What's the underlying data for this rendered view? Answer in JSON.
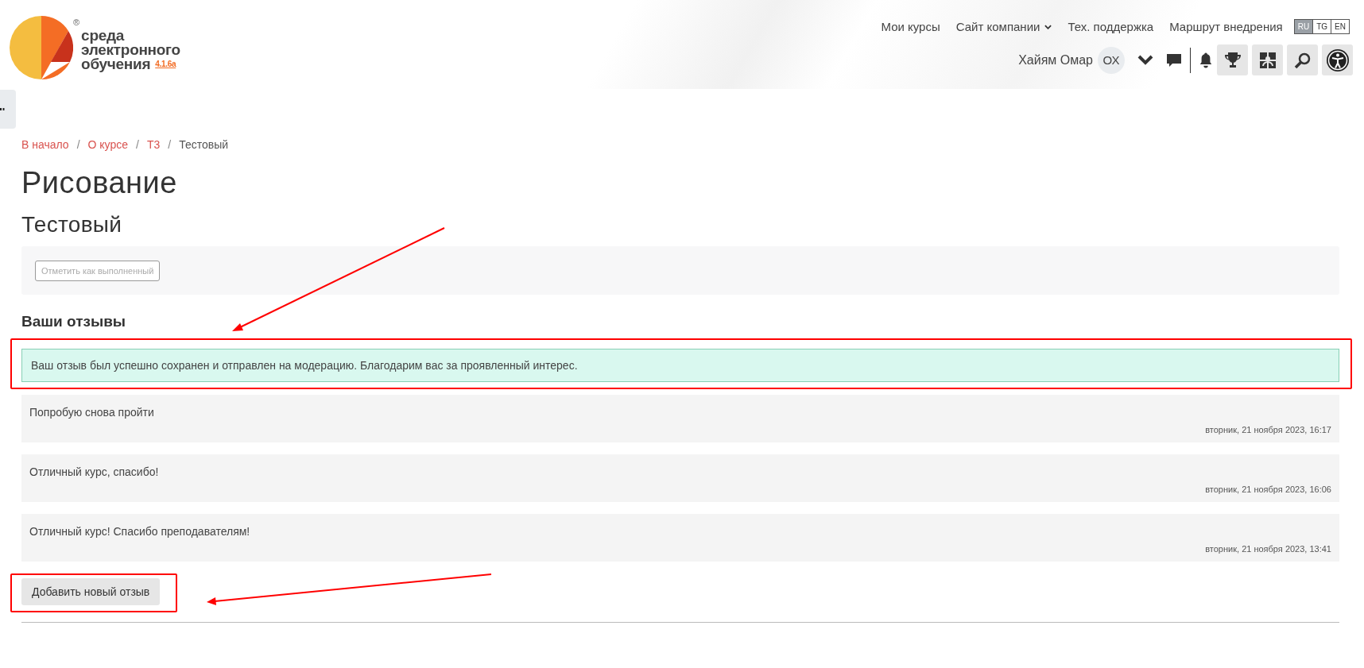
{
  "logo": {
    "registered": "®",
    "lines": [
      "среда",
      "электронного",
      "обучения"
    ],
    "version": "4.1.6a"
  },
  "nav": [
    {
      "label": "Мои курсы",
      "kind": "link"
    },
    {
      "label": "Сайт компании",
      "kind": "dropdown"
    },
    {
      "label": "Тех. поддержка",
      "kind": "link"
    },
    {
      "label": "Маршрут внедрения",
      "kind": "link"
    }
  ],
  "languages": [
    {
      "label": "RU",
      "selected": true
    },
    {
      "label": "TG",
      "selected": false
    },
    {
      "label": "EN",
      "selected": false
    }
  ],
  "user": {
    "name": "Хайям Омар",
    "initials": "ОХ"
  },
  "breadcrumb_separator": "/",
  "breadcrumb": [
    {
      "label": "В начало",
      "current": false
    },
    {
      "label": "О курсе",
      "current": false
    },
    {
      "label": "Т3",
      "current": false
    },
    {
      "label": "Тестовый",
      "current": true
    }
  ],
  "title": "Рисование",
  "subtitle": "Тестовый",
  "complete_button": {
    "label": "Отметить как выполненный",
    "disabled": true
  },
  "reviews_heading": "Ваши отзывы",
  "alert": "Ваш отзыв был успешно сохранен и отправлен на модерацию. Благодарим вас за проявленный интерес.",
  "reviews": [
    {
      "text": "Попробую снова пройти",
      "date": "вторник, 21 ноября 2023, 16:17"
    },
    {
      "text": "Отличный курс, спасибо!",
      "date": "вторник, 21 ноября 2023, 16:06"
    },
    {
      "text": "Отличный курс! Спасибо преподавателям!",
      "date": "вторник, 21 ноября 2023, 13:41"
    }
  ],
  "add_button": "Добавить новый отзыв"
}
